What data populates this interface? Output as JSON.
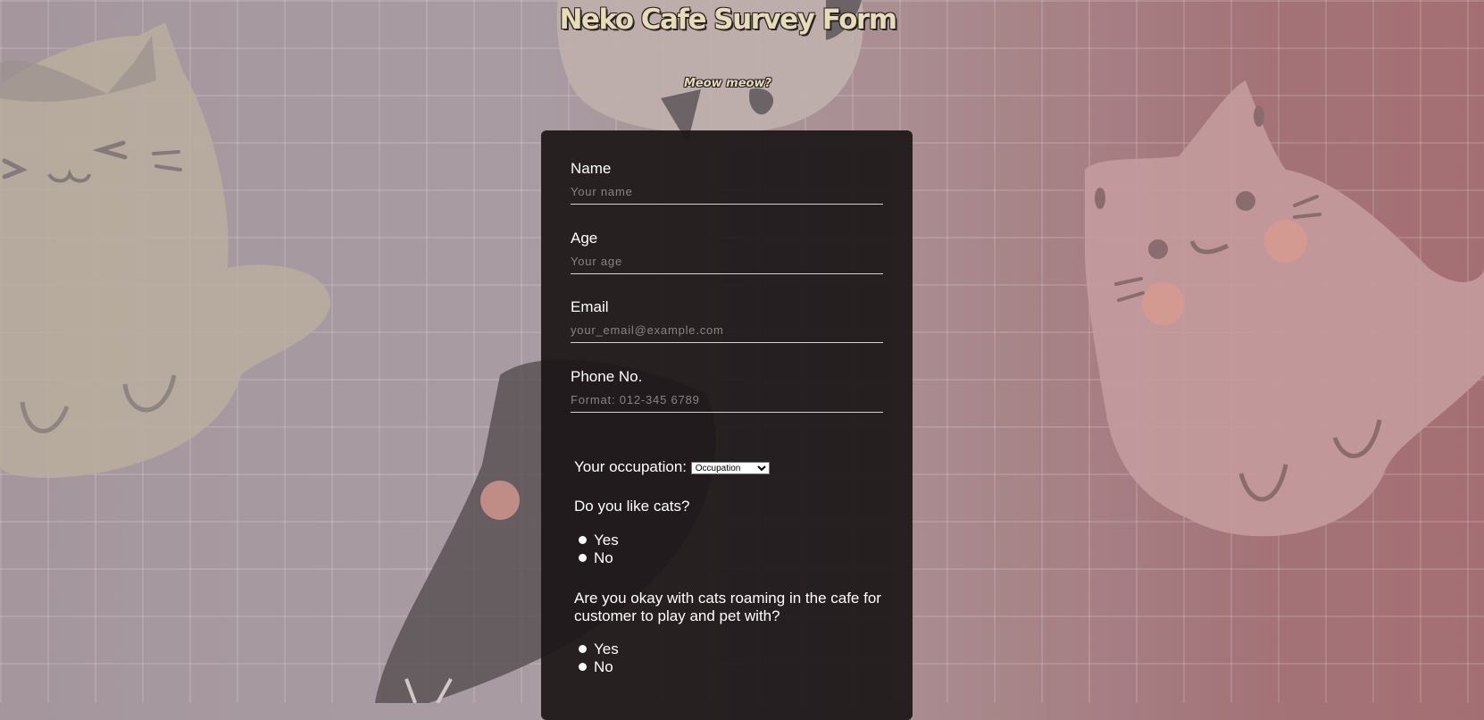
{
  "header": {
    "title": "Neko Cafe Survey Form",
    "subtitle": "Meow meow?"
  },
  "form": {
    "name": {
      "label": "Name",
      "placeholder": "Your name",
      "value": ""
    },
    "age": {
      "label": "Age",
      "placeholder": "Your age",
      "value": ""
    },
    "email": {
      "label": "Email",
      "placeholder": "your_email@example.com",
      "value": ""
    },
    "phone": {
      "label": "Phone No.",
      "placeholder": "Format: 012-345 6789",
      "value": ""
    },
    "occupation": {
      "label": "Your occupation:",
      "selected": "Occupation",
      "options": [
        "Occupation"
      ]
    },
    "q_like_cats": {
      "question": "Do you like cats?",
      "options": [
        "Yes",
        "No"
      ]
    },
    "q_roaming": {
      "question": "Are you okay with cats roaming in the cafe for customer to play and pet with?",
      "options": [
        "Yes",
        "No"
      ]
    }
  },
  "colors": {
    "title_fill": "#e6dcb8",
    "form_bg": "#1c1718",
    "bg_left": "#a4969c",
    "bg_right": "#a46f73"
  }
}
